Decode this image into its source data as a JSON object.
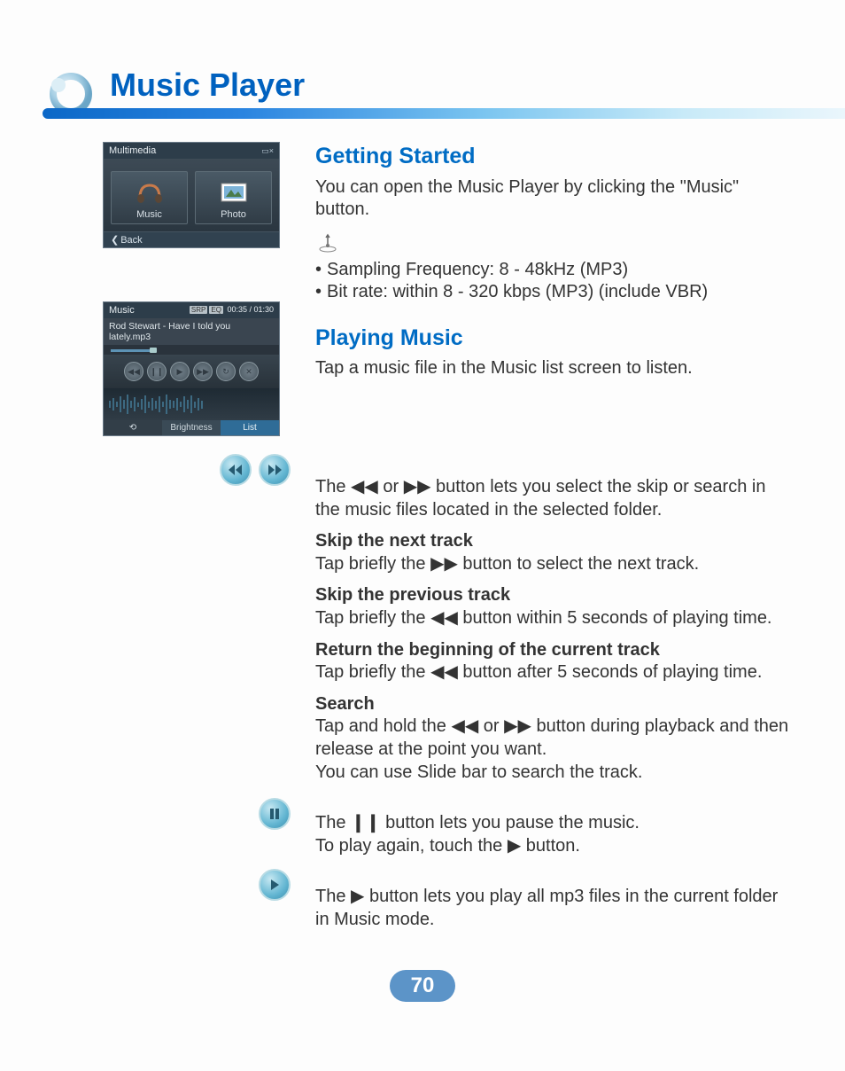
{
  "page_title": "Music Player",
  "page_number": "70",
  "screenshot1": {
    "header": "Multimedia",
    "cells": [
      {
        "label": "Music"
      },
      {
        "label": "Photo"
      }
    ],
    "back_label": "Back"
  },
  "screenshot2": {
    "header": "Music",
    "badge1": "SRP",
    "badge2": "EQ",
    "time": "00:35 / 01:30",
    "track": "Rod Stewart - Have I told you lately.mp3",
    "footer": {
      "a": "⟲",
      "b": "Brightness",
      "c": "List"
    }
  },
  "section1": {
    "heading": "Getting Started",
    "p1": "You can open the Music Player by clicking the \"Music\" button.",
    "bullet1": "Sampling Frequency: 8 - 48kHz (MP3)",
    "bullet2": "Bit rate: within 8 - 320 kbps (MP3) (include VBR)"
  },
  "section2": {
    "heading": "Playing Music",
    "p1": "Tap a music file in the Music list screen to listen."
  },
  "skip": {
    "intro_a": "The ",
    "intro_b": " or ",
    "intro_c": " button lets you select the skip or search in the music files located in the selected folder.",
    "next_h": "Skip the next track",
    "next_a": "Tap briefly the ",
    "next_b": " button to select the next track.",
    "prev_h": "Skip the previous track",
    "prev_a": "Tap briefly the ",
    "prev_b": " button within 5 seconds of playing time.",
    "return_h": "Return the beginning of the current track",
    "return_a": "Tap briefly the ",
    "return_b": " button after 5 seconds of playing time.",
    "search_h": "Search",
    "search_a": "Tap and hold the ",
    "search_b": " or ",
    "search_c": " button during playback and then release at the point you want.",
    "search_d": "You can use Slide bar to search the track."
  },
  "pause": {
    "p1a": "The ",
    "p1b": " button lets you pause the music.",
    "p2a": "To play again, touch the ",
    "p2b": " button."
  },
  "play": {
    "p1a": "The ",
    "p1b": " button lets you play all mp3 files in the current folder in Music mode."
  },
  "symbols": {
    "rew": "◀◀",
    "fwd": "▶▶",
    "pause": "❙❙",
    "play": "▶",
    "bullet": "•"
  }
}
